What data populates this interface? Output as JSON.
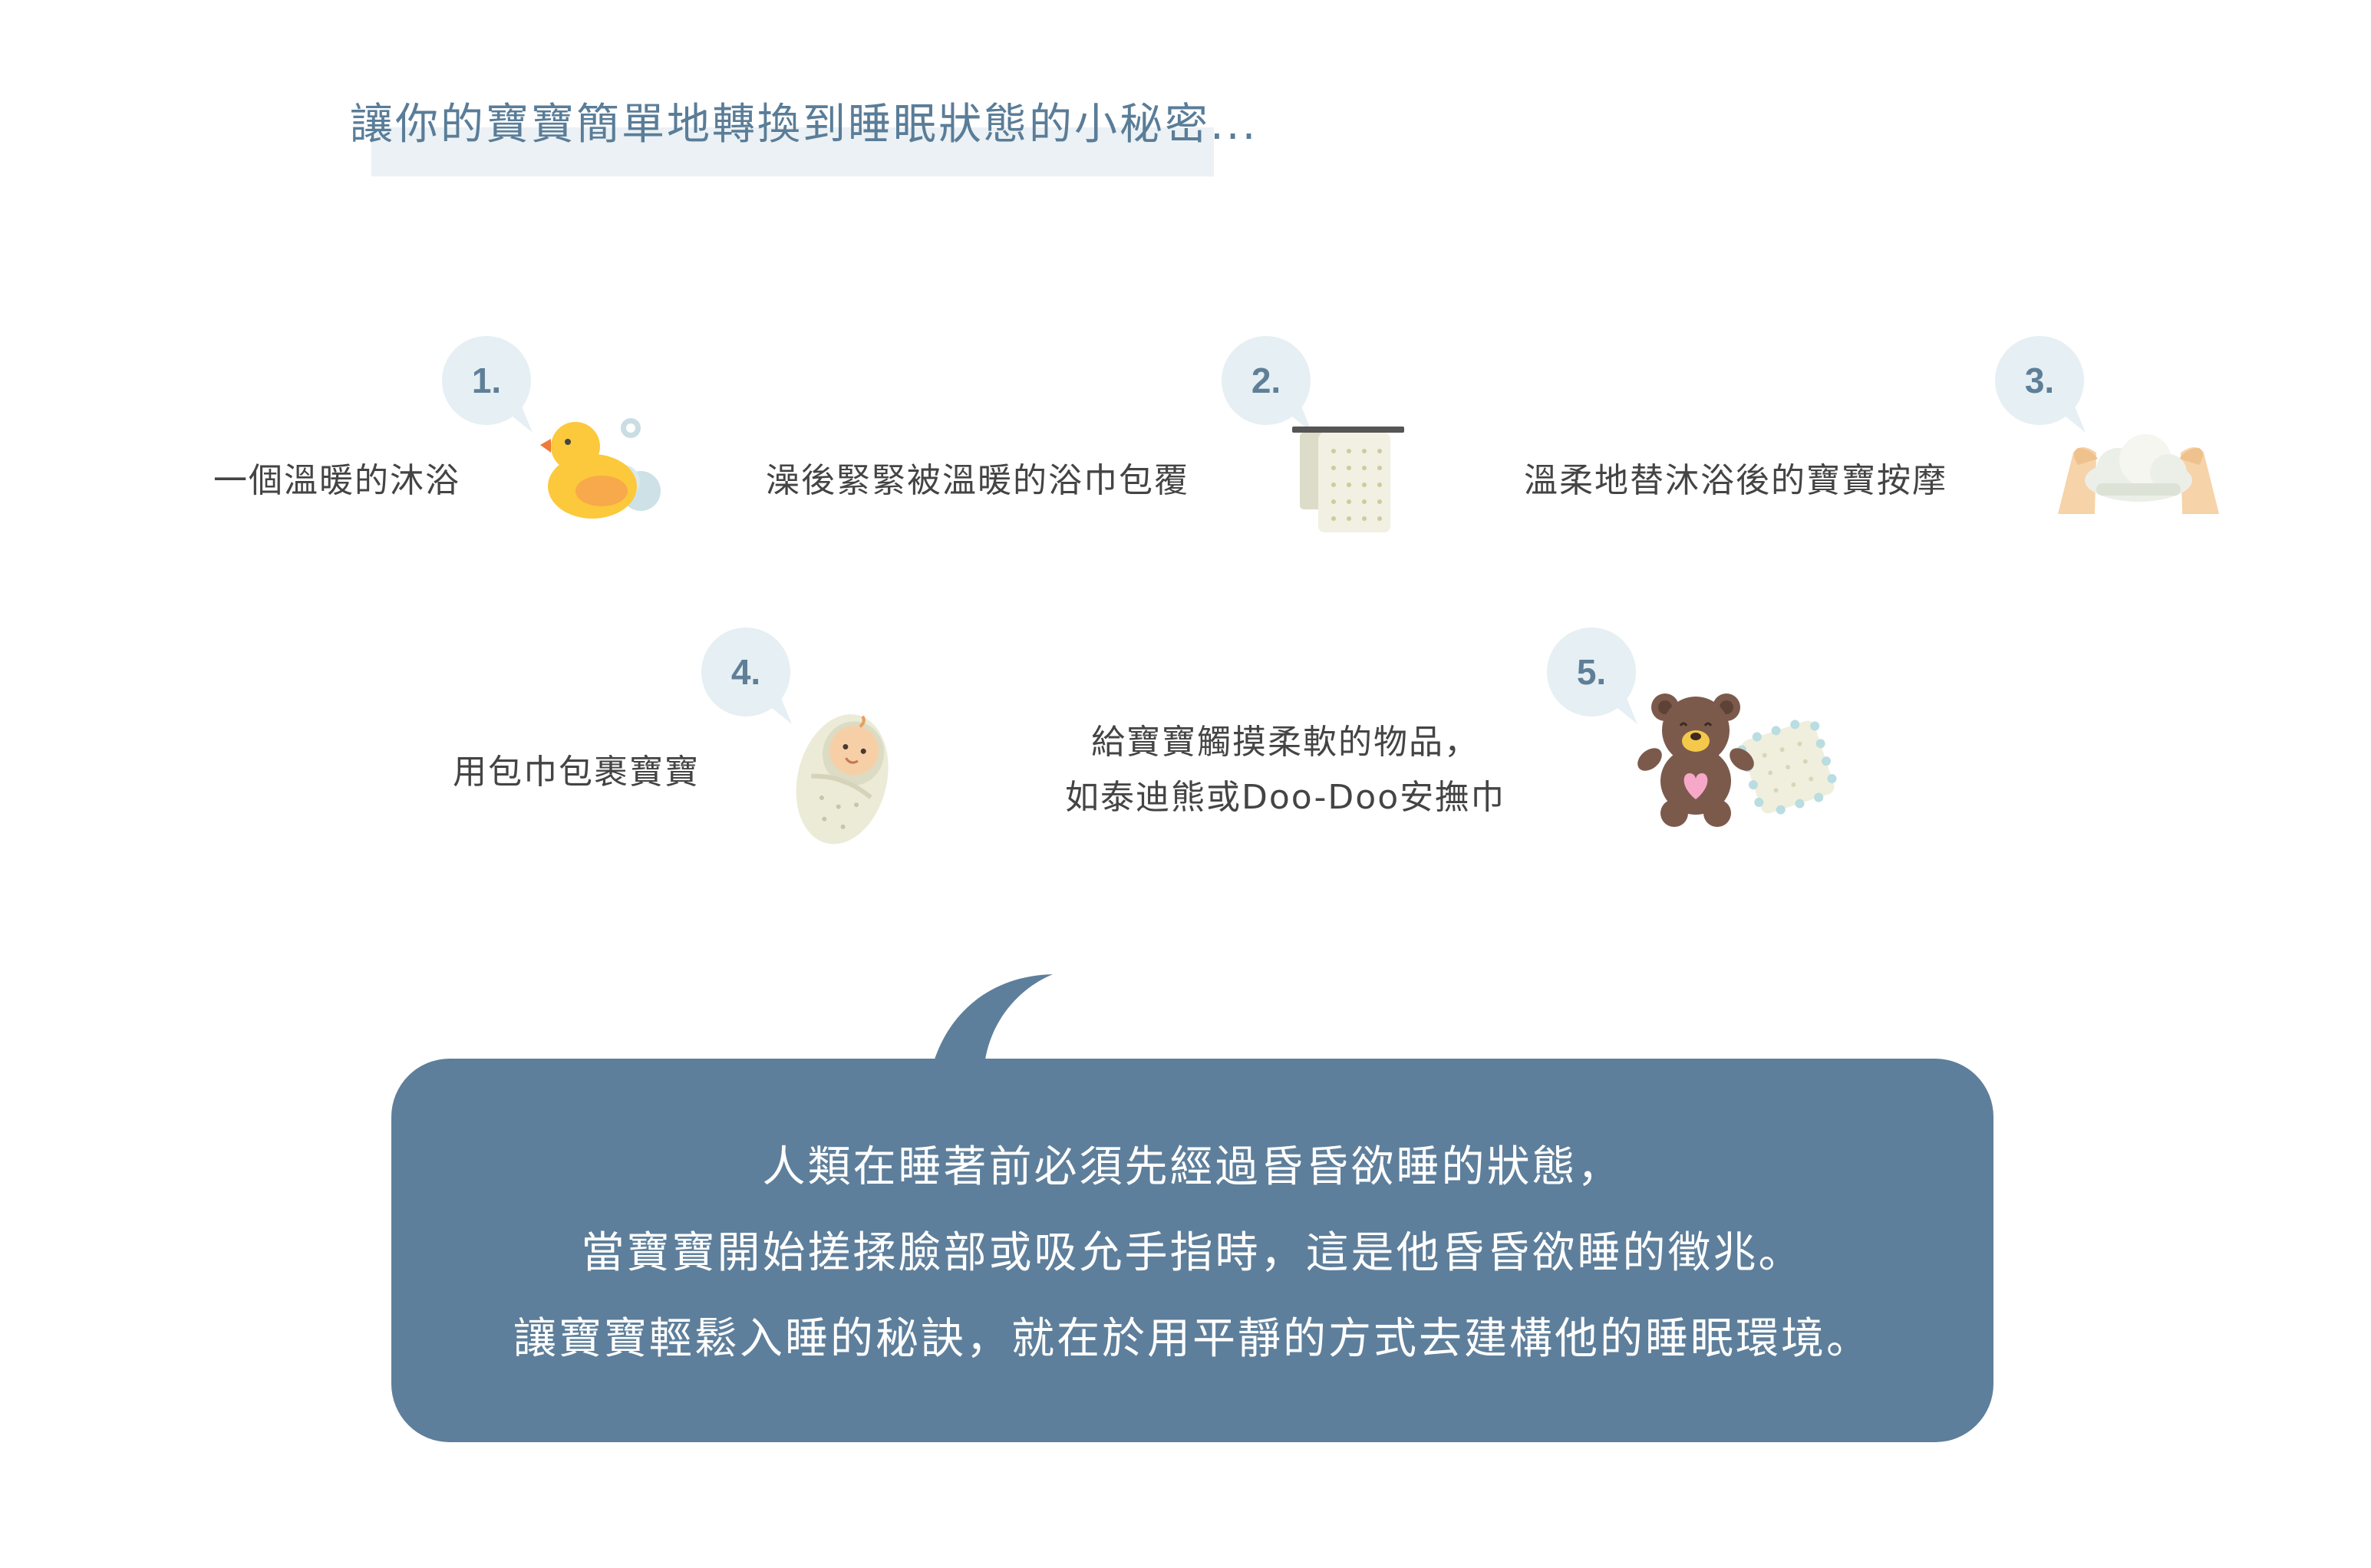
{
  "title": "讓你的寶寶簡單地轉換到睡眠狀態的小秘密...",
  "steps": [
    {
      "number": "1.",
      "label": "一個溫暖的沐浴",
      "icon": "rubber-duck-icon"
    },
    {
      "number": "2.",
      "label": "澡後緊緊被溫暖的浴巾包覆",
      "icon": "towel-icon"
    },
    {
      "number": "3.",
      "label": "溫柔地替沐浴後的寶寶按摩",
      "icon": "massage-hands-icon"
    },
    {
      "number": "4.",
      "label": "用包巾包裹寶寶",
      "icon": "swaddled-baby-icon"
    },
    {
      "number": "5.",
      "label_lines": [
        "給寶寶觸摸柔軟的物品，",
        "如泰迪熊或Doo-Doo安撫巾"
      ],
      "icon": "teddy-bear-icon"
    }
  ],
  "message": {
    "lines": [
      "人類在睡著前必須先經過昏昏欲睡的狀態，",
      "當寶寶開始搓揉臉部或吸允手指時，這是他昏昏欲睡的徵兆。",
      "讓寶寶輕鬆入睡的秘訣，就在於用平靜的方式去建構他的睡眠環境。"
    ]
  },
  "colors": {
    "accent": "#5e7f9b",
    "bubble": "#e6eff3",
    "title_highlight": "#ebf1f4",
    "duck": "#fbc93b",
    "teddy": "#7b5a4c",
    "towel": "#f1f0e2"
  }
}
